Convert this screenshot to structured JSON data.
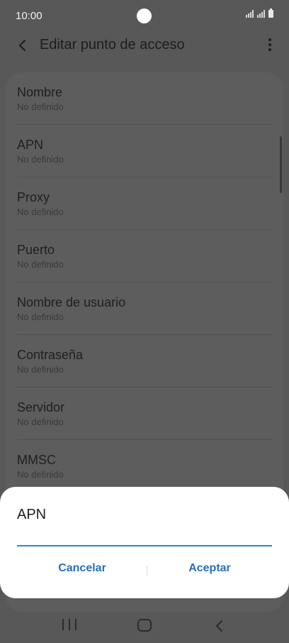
{
  "status_bar": {
    "time": "10:00"
  },
  "header": {
    "title": "Editar punto de acceso"
  },
  "list": {
    "items": [
      {
        "label": "Nombre",
        "value": "No definido"
      },
      {
        "label": "APN",
        "value": "No definido"
      },
      {
        "label": "Proxy",
        "value": "No definido"
      },
      {
        "label": "Puerto",
        "value": "No definido"
      },
      {
        "label": "Nombre de usuario",
        "value": "No definido"
      },
      {
        "label": "Contraseña",
        "value": "No definido"
      },
      {
        "label": "Servidor",
        "value": "No definido"
      },
      {
        "label": "MMSC",
        "value": "No definido"
      }
    ]
  },
  "dialog": {
    "title": "APN",
    "input_value": "",
    "cancel_label": "Cancelar",
    "accept_label": "Aceptar"
  },
  "colors": {
    "accent": "#2a6eb8",
    "input_underline": "#2a86d1",
    "dim_background": "#585858",
    "dialog_background": "#ffffff"
  }
}
